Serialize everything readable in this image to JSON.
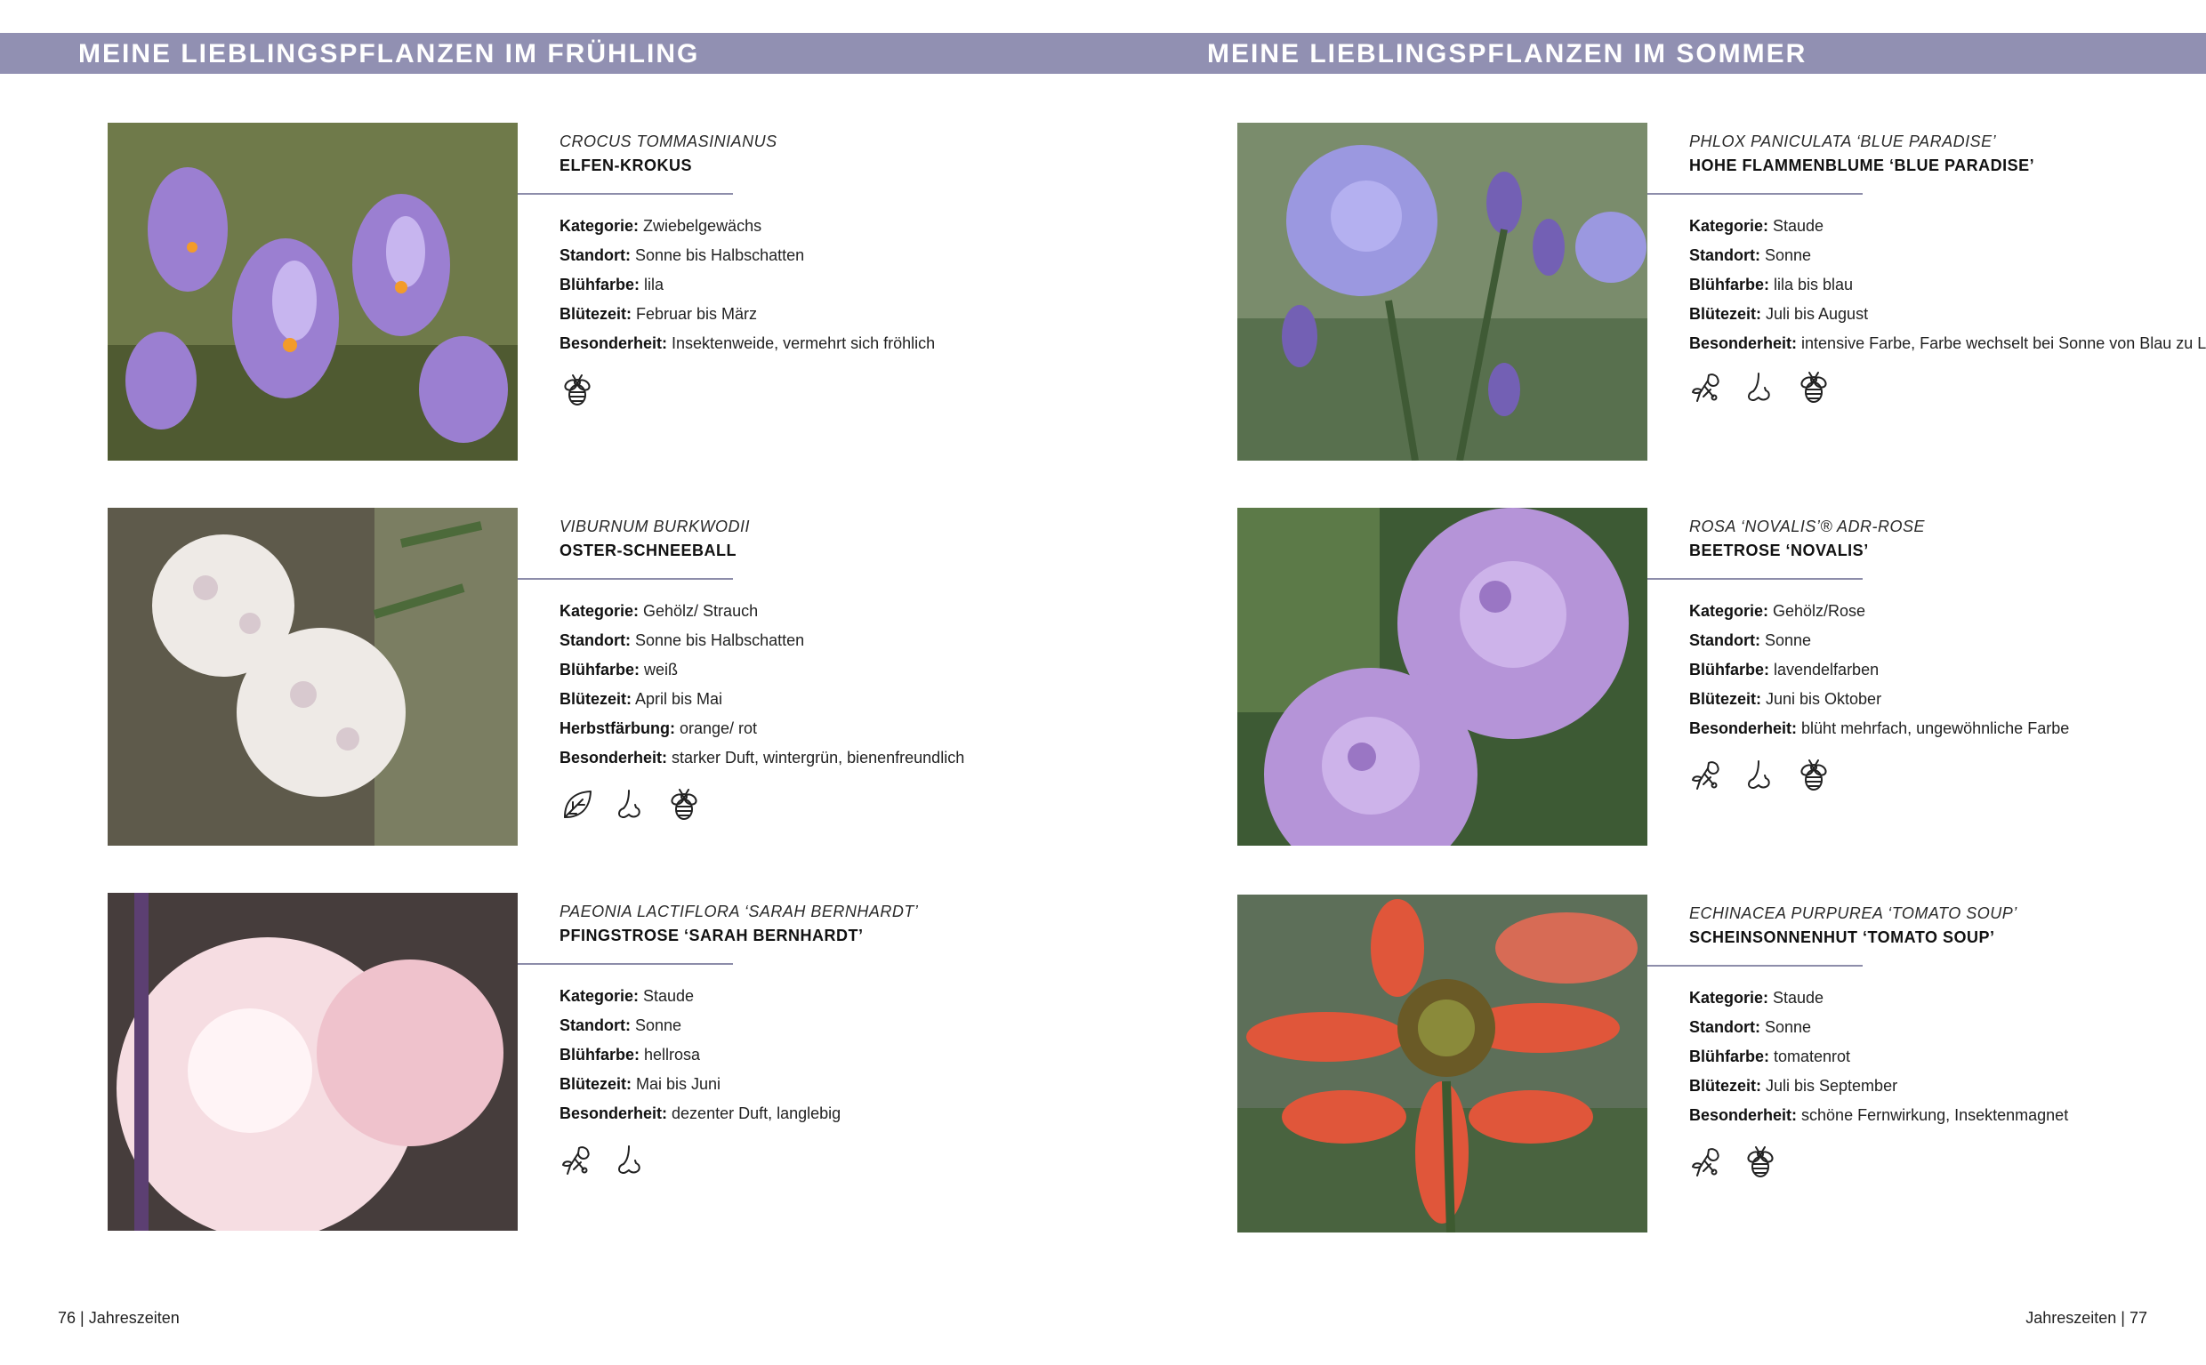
{
  "headers": {
    "left": "MEINE LIEBLINGSPFLANZEN IM FRÜHLING",
    "right": "MEINE LIEBLINGSPFLANZEN IM SOMMER"
  },
  "footer": {
    "left_page": "76",
    "left_section": "Jahreszeiten",
    "right_section": "Jahreszeiten",
    "right_page": "77",
    "separator": "|"
  },
  "labels": {
    "kategorie": "Kategorie:",
    "standort": "Standort:",
    "bluehfarbe": "Blühfarbe:",
    "bluetezeit": "Blütezeit:",
    "herbstfaerbung": "Herbstfärbung:",
    "besonderheit": "Besonderheit:"
  },
  "plants": [
    {
      "latin": "Crocus tommasinianus",
      "german": "Elfen-Krokus",
      "kategorie": "Zwiebelgewächs",
      "standort": "Sonne bis Halbschatten",
      "bluehfarbe": "lila",
      "bluetezeit": "Februar bis März",
      "besonderheit": "Insektenweide, vermehrt sich fröhlich",
      "icons": [
        "bee-icon"
      ]
    },
    {
      "latin": "Viburnum burkwodii",
      "german": "Oster-Schneeball",
      "kategorie": "Gehölz/ Strauch",
      "standort": "Sonne bis Halbschatten",
      "bluehfarbe": "weiß",
      "bluetezeit": "April bis Mai",
      "herbstfaerbung": "orange/ rot",
      "besonderheit": "starker Duft, wintergrün, bienenfreundlich",
      "icons": [
        "leaf-icon",
        "nose-icon",
        "bee-icon"
      ]
    },
    {
      "latin": "Paeonia lactiflora ‘Sarah Bernhardt’",
      "german": "Pfingstrose ‘Sarah Bernhardt’",
      "kategorie": "Staude",
      "standort": "Sonne",
      "bluehfarbe": "hellrosa",
      "bluetezeit": "Mai bis Juni",
      "besonderheit": "dezenter Duft, langlebig",
      "icons": [
        "cut-flower-icon",
        "nose-icon"
      ]
    },
    {
      "latin": "Phlox paniculata ‘Blue Paradise’",
      "german": "Hohe Flammenblume ‘Blue Paradise’",
      "kategorie": "Staude",
      "standort": "Sonne",
      "bluehfarbe": "lila bis blau",
      "bluetezeit": "Juli bis August",
      "besonderheit": "intensive Farbe, Farbe wechselt bei Sonne von Blau zu Lila",
      "icons": [
        "cut-flower-icon",
        "nose-icon",
        "bee-icon"
      ]
    },
    {
      "latin": "Rosa ‘Novalis’® ADR-Rose",
      "german": "Beetrose ‘Novalis’",
      "kategorie": "Gehölz/Rose",
      "standort": "Sonne",
      "bluehfarbe": "lavendelfarben",
      "bluetezeit": "Juni bis Oktober",
      "besonderheit": "blüht mehrfach, ungewöhnliche Farbe",
      "icons": [
        "cut-flower-icon",
        "nose-icon",
        "bee-icon"
      ]
    },
    {
      "latin": "Echinacea purpurea ‘Tomato Soup’",
      "german": "Scheinsonnenhut ‘Tomato Soup’",
      "kategorie": "Staude",
      "standort": "Sonne",
      "bluehfarbe": "tomatenrot",
      "bluetezeit": "Juli bis September",
      "besonderheit": "schöne Fernwirkung, Insektenmagnet",
      "icons": [
        "cut-flower-icon",
        "bee-icon"
      ]
    }
  ],
  "colors": {
    "banner": "#9190b2",
    "rule": "#8d8daa"
  }
}
